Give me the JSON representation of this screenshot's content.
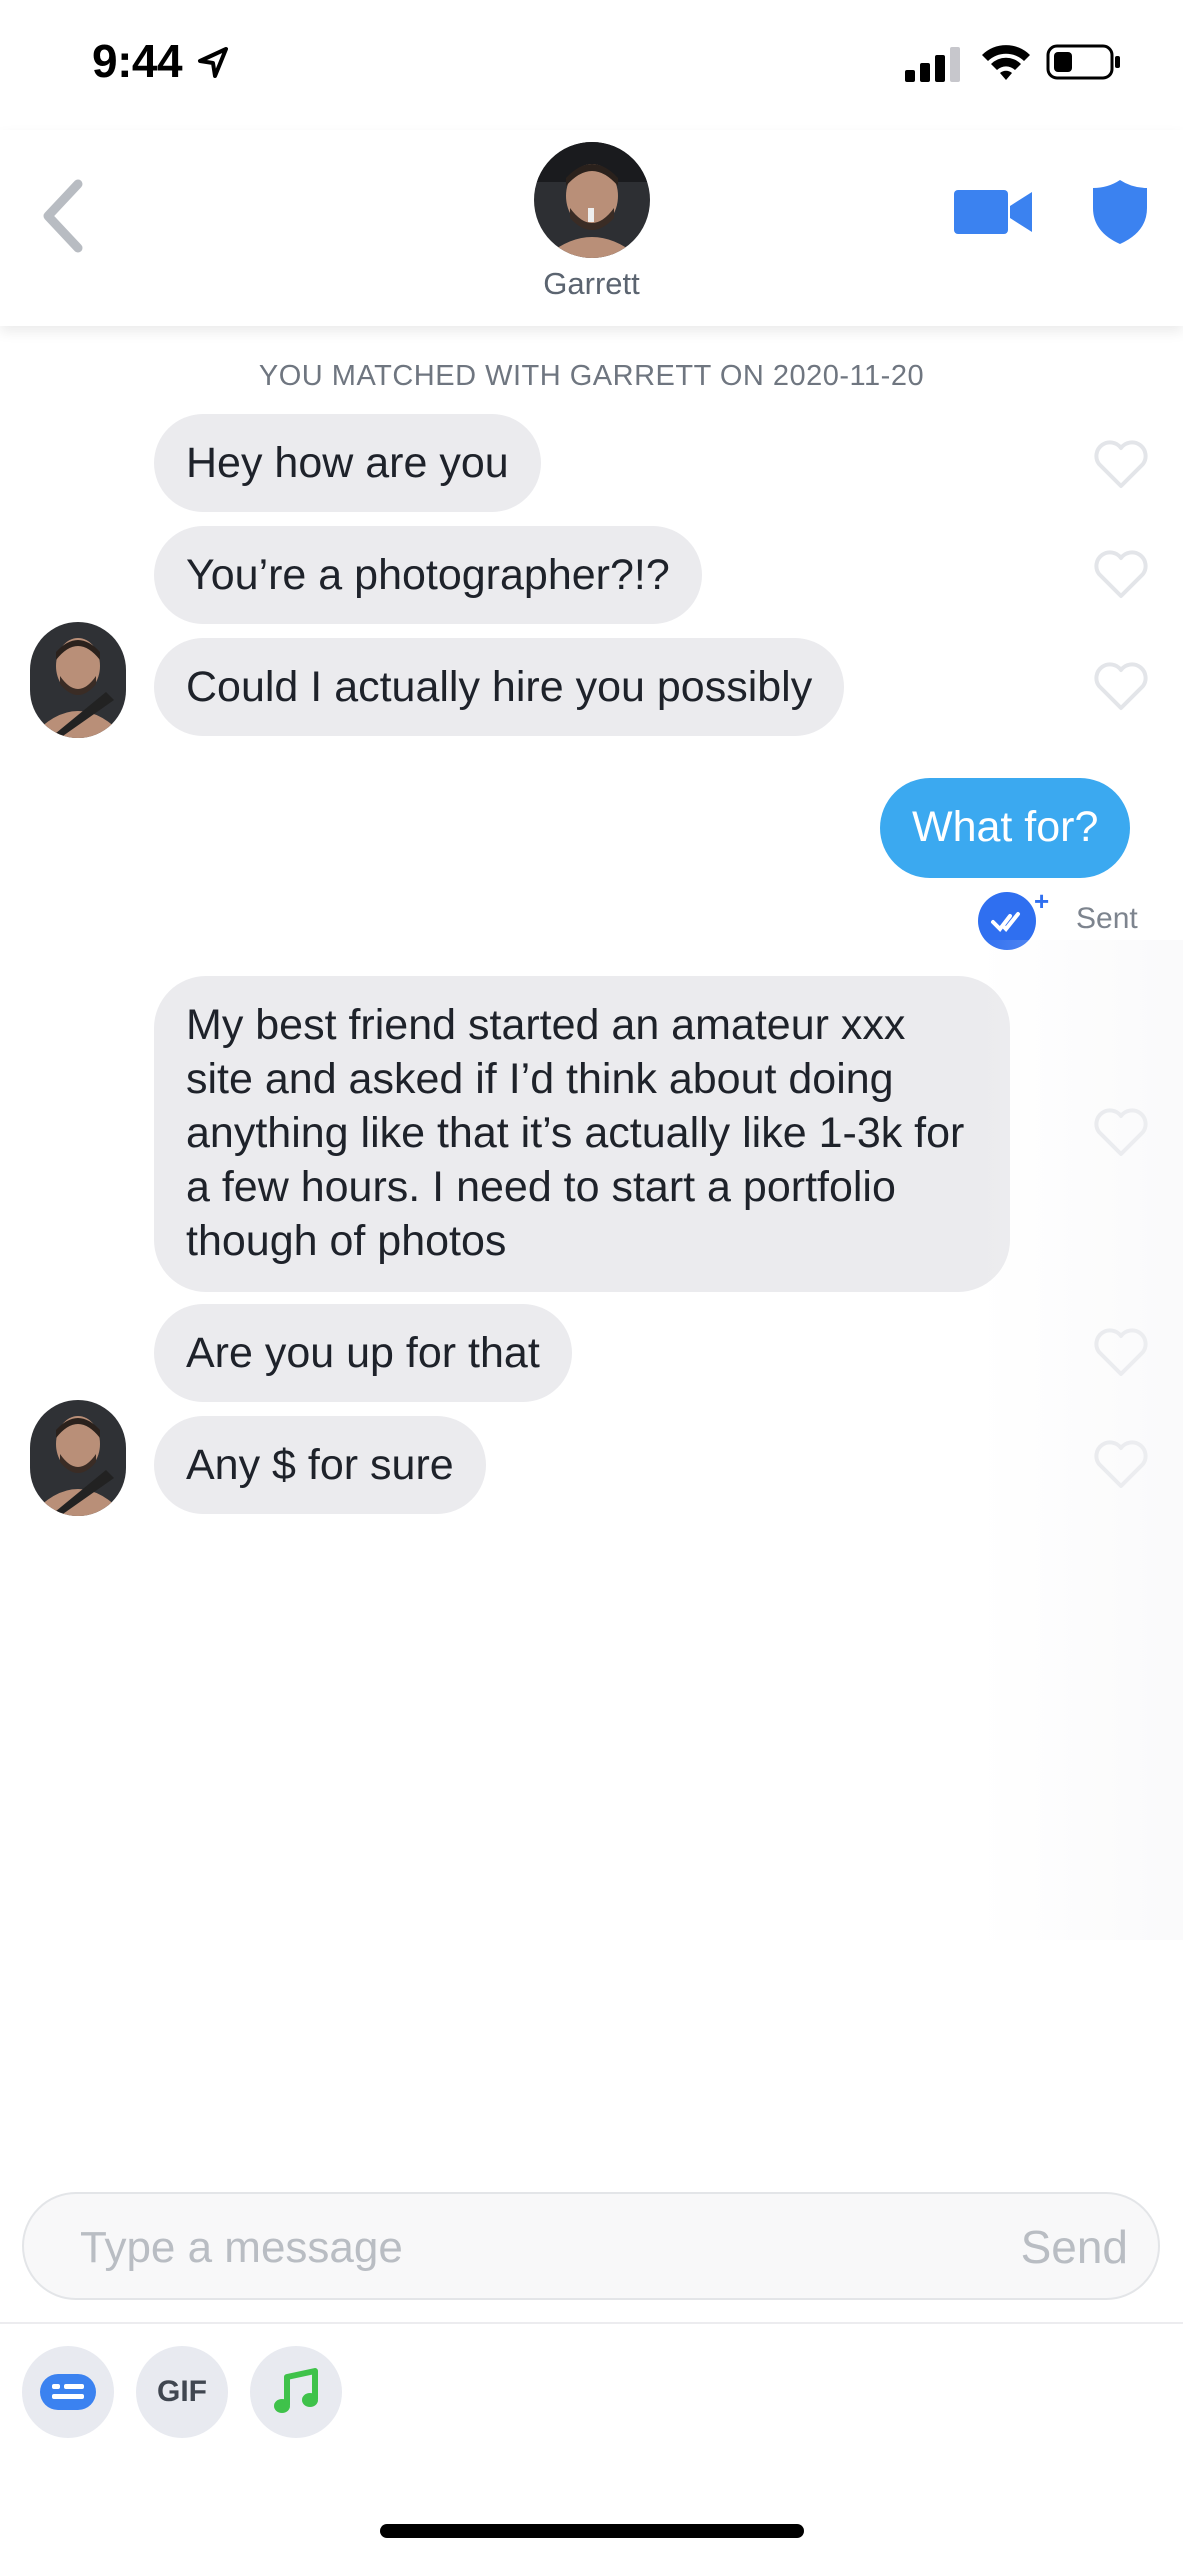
{
  "status_bar": {
    "time": "9:44"
  },
  "header": {
    "contact_name": "Garrett",
    "icons": {
      "back": "chevron-left-icon",
      "video": "video-camera-icon",
      "safety": "shield-icon"
    },
    "accent_color": "#3b82f0"
  },
  "chat": {
    "match_note": "YOU MATCHED WITH GARRETT ON 2020-11-20",
    "messages": [
      {
        "from": "them",
        "text": "Hey how are you"
      },
      {
        "from": "them",
        "text": "You’re a photographer?!?"
      },
      {
        "from": "them",
        "text": "Could I actually hire you possibly"
      },
      {
        "from": "me",
        "text": "What for?"
      },
      {
        "from": "them",
        "text": "My best friend started an amateur xxx site and asked if I’d think about doing anything like that it’s actually like 1-3k for a few hours. I need to start a portfolio though of photos"
      },
      {
        "from": "them",
        "text": "Are you up for that"
      },
      {
        "from": "them",
        "text": "Any $ for sure"
      }
    ],
    "sent_status": "Sent",
    "my_bubble_color": "#3ba9f0",
    "their_bubble_color": "#ebebee"
  },
  "composer": {
    "placeholder": "Type a message",
    "send_label": "Send"
  },
  "actions": {
    "gif_label": "GIF",
    "icons": [
      "sticker-icon",
      "gif-icon",
      "music-note-icon"
    ]
  }
}
